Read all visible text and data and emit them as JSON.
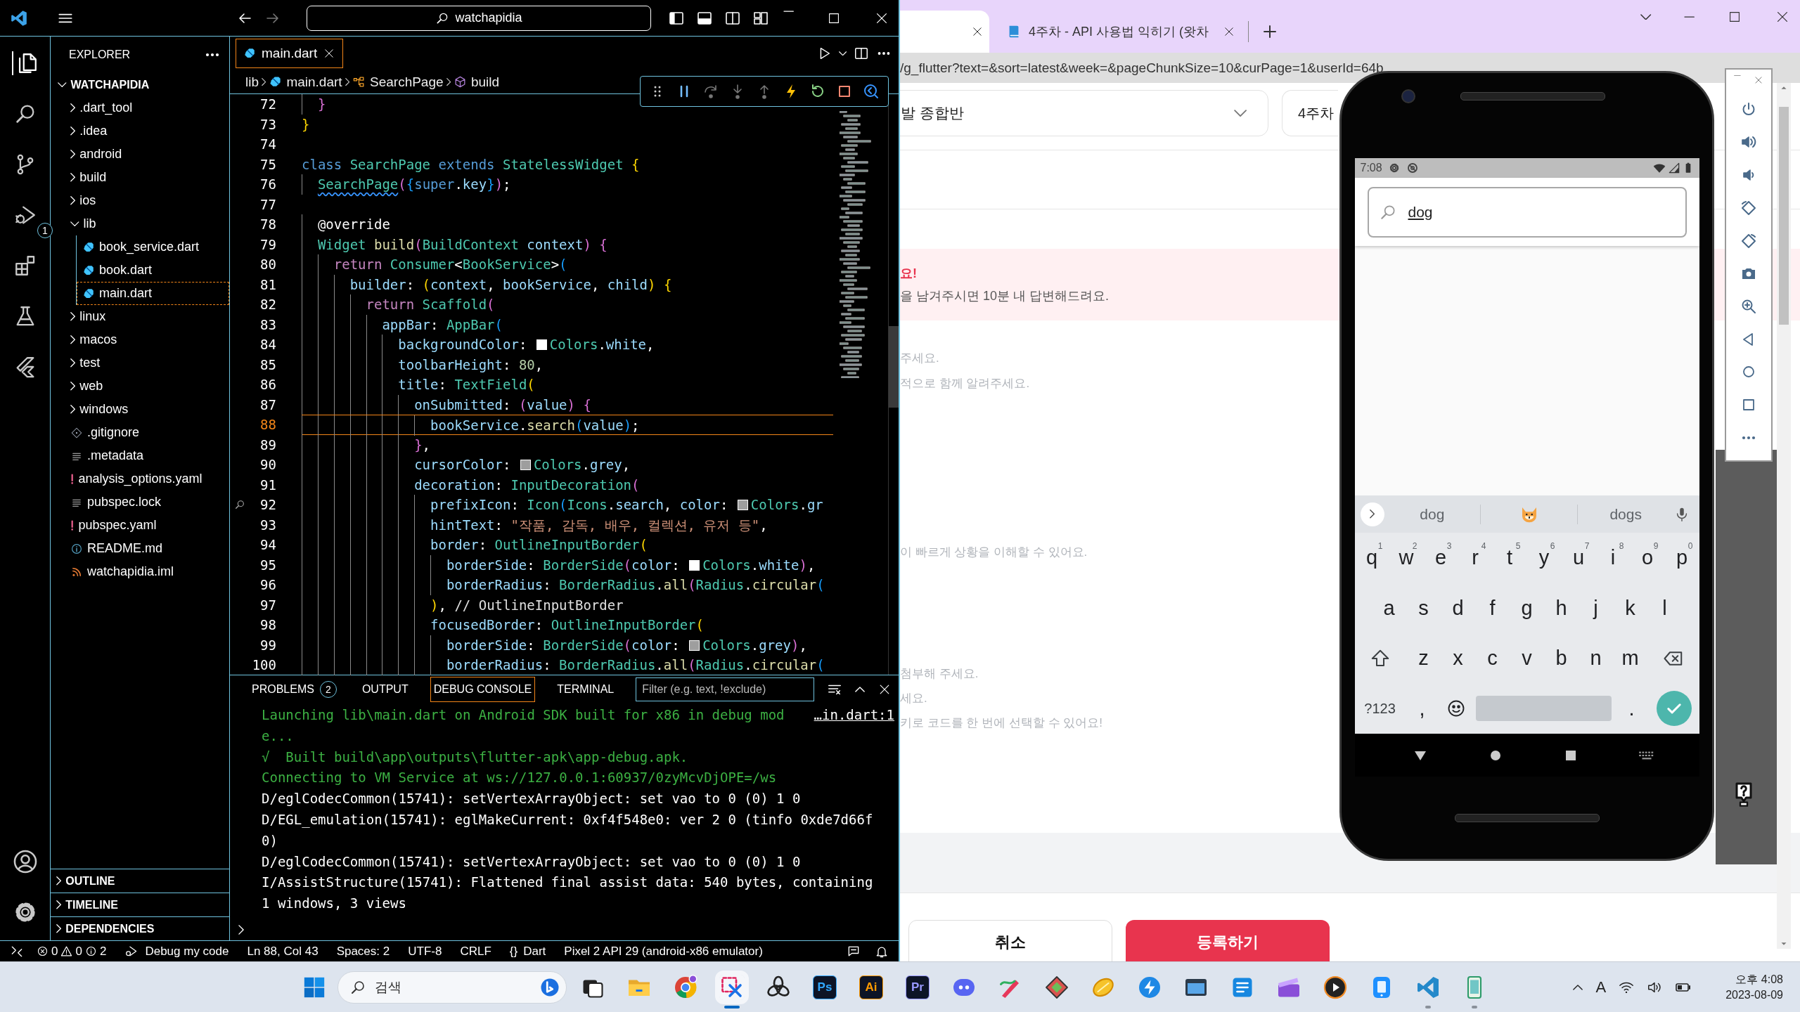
{
  "vscode": {
    "title_bar": {
      "search": "watchapidia"
    },
    "activity_bar": {
      "items": [
        {
          "kind": "explorer",
          "selected": true
        },
        {
          "kind": "search",
          "selected": false
        },
        {
          "kind": "source-control",
          "selected": false
        },
        {
          "kind": "run-debug",
          "selected": false,
          "badge": "1"
        },
        {
          "kind": "extensions",
          "selected": false
        },
        {
          "kind": "testing",
          "selected": false
        },
        {
          "kind": "flutter",
          "selected": false
        }
      ],
      "bottom": [
        {
          "kind": "account"
        },
        {
          "kind": "settings"
        }
      ]
    },
    "sidebar": {
      "title": "EXPLORER",
      "root": "WATCHAPIDIA",
      "root_expanded": true,
      "tree": [
        {
          "label": ".dart_tool",
          "kind": "folder",
          "expanded": false,
          "selected": false
        },
        {
          "label": ".idea",
          "kind": "folder",
          "expanded": false,
          "selected": false
        },
        {
          "label": "android",
          "kind": "folder",
          "expanded": false,
          "selected": false
        },
        {
          "label": "build",
          "kind": "folder",
          "expanded": false,
          "selected": false
        },
        {
          "label": "ios",
          "kind": "folder",
          "expanded": false,
          "selected": false
        },
        {
          "label": "lib",
          "kind": "folder",
          "expanded": true,
          "selected": false,
          "children": [
            {
              "label": "book_service.dart",
              "kind": "dart",
              "selected": false
            },
            {
              "label": "book.dart",
              "kind": "dart",
              "selected": false
            },
            {
              "label": "main.dart",
              "kind": "dart",
              "selected": true
            }
          ]
        },
        {
          "label": "linux",
          "kind": "folder",
          "expanded": false,
          "selected": false
        },
        {
          "label": "macos",
          "kind": "folder",
          "expanded": false,
          "selected": false
        },
        {
          "label": "test",
          "kind": "folder",
          "expanded": false,
          "selected": false
        },
        {
          "label": "web",
          "kind": "folder",
          "expanded": false,
          "selected": false
        },
        {
          "label": "windows",
          "kind": "folder",
          "expanded": false,
          "selected": false
        },
        {
          "label": ".gitignore",
          "kind": "git",
          "selected": false
        },
        {
          "label": ".metadata",
          "kind": "text",
          "selected": false
        },
        {
          "label": "analysis_options.yaml",
          "kind": "yaml",
          "selected": false
        },
        {
          "label": "pubspec.lock",
          "kind": "text",
          "selected": false
        },
        {
          "label": "pubspec.yaml",
          "kind": "yaml",
          "selected": false
        },
        {
          "label": "README.md",
          "kind": "info",
          "selected": false
        },
        {
          "label": "watchapidia.iml",
          "kind": "feed",
          "selected": false
        }
      ],
      "sections": [
        {
          "label": "OUTLINE",
          "expanded": false
        },
        {
          "label": "TIMELINE",
          "expanded": false
        },
        {
          "label": "DEPENDENCIES",
          "expanded": false
        }
      ]
    },
    "editor": {
      "tabs": [
        {
          "label": "main.dart",
          "selected": true
        }
      ],
      "breadcrumbs": [
        {
          "label": "lib",
          "kind": "folder"
        },
        {
          "label": "main.dart",
          "kind": "dart"
        },
        {
          "label": "SearchPage",
          "kind": "class"
        },
        {
          "label": "build",
          "kind": "method"
        }
      ],
      "lines": [
        {
          "number": "72",
          "current": false,
          "marker": false,
          "tokens": [
            {
              "text": "  }",
              "kind": "b2"
            }
          ]
        },
        {
          "number": "73",
          "current": false,
          "marker": false,
          "tokens": [
            {
              "text": "}",
              "kind": "b1"
            }
          ]
        },
        {
          "number": "74",
          "current": false,
          "marker": false
        },
        {
          "number": "75",
          "current": false,
          "marker": false,
          "tokens": [
            {
              "text": "class ",
              "kind": "kw"
            },
            {
              "text": "SearchPage ",
              "kind": "ty"
            },
            {
              "text": "extends ",
              "kind": "kw"
            },
            {
              "text": "StatelessWidget ",
              "kind": "ty"
            },
            {
              "text": "{",
              "kind": "b1"
            }
          ]
        },
        {
          "number": "76",
          "current": false,
          "marker": false,
          "tokens": [
            {
              "text": "  SearchPage",
              "kind": "warn"
            },
            {
              "text": "(",
              "kind": "b2"
            },
            {
              "text": "{",
              "kind": "b3"
            },
            {
              "text": "super",
              "kind": "kw"
            },
            {
              "text": ".",
              "kind": "p"
            },
            {
              "text": "key",
              "kind": "prop"
            },
            {
              "text": "}",
              "kind": "b3"
            },
            {
              "text": ")",
              "kind": "b2"
            },
            {
              "text": ";",
              "kind": "p"
            }
          ]
        },
        {
          "number": "77",
          "current": false,
          "marker": false
        },
        {
          "number": "78",
          "current": false,
          "marker": false,
          "tokens": [
            {
              "text": "  @override",
              "kind": "p"
            }
          ]
        },
        {
          "number": "79",
          "current": false,
          "marker": false,
          "tokens": [
            {
              "text": "  Widget ",
              "kind": "ty"
            },
            {
              "text": "build",
              "kind": "fn"
            },
            {
              "text": "(",
              "kind": "b2"
            },
            {
              "text": "BuildContext ",
              "kind": "ty"
            },
            {
              "text": "context",
              "kind": "prop"
            },
            {
              "text": ")",
              "kind": "b2"
            },
            {
              "text": " {",
              "kind": "b2"
            }
          ]
        },
        {
          "number": "80",
          "current": false,
          "marker": false,
          "tokens": [
            {
              "text": "    return ",
              "kind": "ctl"
            },
            {
              "text": "Consumer",
              "kind": "ty"
            },
            {
              "text": "<",
              "kind": "p"
            },
            {
              "text": "BookService",
              "kind": "ty"
            },
            {
              "text": ">",
              "kind": "p"
            },
            {
              "text": "(",
              "kind": "b3"
            }
          ]
        },
        {
          "number": "81",
          "current": false,
          "marker": false,
          "tokens": [
            {
              "text": "      builder",
              "kind": "prop"
            },
            {
              "text": ": ",
              "kind": "p"
            },
            {
              "text": "(",
              "kind": "b1"
            },
            {
              "text": "context",
              "kind": "prop"
            },
            {
              "text": ", ",
              "kind": "p"
            },
            {
              "text": "bookService",
              "kind": "prop"
            },
            {
              "text": ", ",
              "kind": "p"
            },
            {
              "text": "child",
              "kind": "prop"
            },
            {
              "text": ")",
              "kind": "b1"
            },
            {
              "text": " {",
              "kind": "b1"
            }
          ]
        },
        {
          "number": "82",
          "current": false,
          "marker": false,
          "tokens": [
            {
              "text": "        return ",
              "kind": "ctl"
            },
            {
              "text": "Scaffold",
              "kind": "ty"
            },
            {
              "text": "(",
              "kind": "b2"
            }
          ]
        },
        {
          "number": "83",
          "current": false,
          "marker": false,
          "tokens": [
            {
              "text": "          appBar",
              "kind": "prop"
            },
            {
              "text": ": ",
              "kind": "p"
            },
            {
              "text": "AppBar",
              "kind": "ty"
            },
            {
              "text": "(",
              "kind": "b3"
            }
          ]
        },
        {
          "number": "84",
          "current": false,
          "marker": false,
          "tokens": [
            {
              "text": "            backgroundColor",
              "kind": "prop"
            },
            {
              "text": ": ",
              "kind": "p"
            },
            {
              "kind": "swatch",
              "color": "#ffffff"
            },
            {
              "text": "Colors",
              "kind": "ty"
            },
            {
              "text": ".",
              "kind": "p"
            },
            {
              "text": "white",
              "kind": "prop"
            },
            {
              "text": ",",
              "kind": "p"
            }
          ]
        },
        {
          "number": "85",
          "current": false,
          "marker": false,
          "tokens": [
            {
              "text": "            toolbarHeight",
              "kind": "prop"
            },
            {
              "text": ": ",
              "kind": "p"
            },
            {
              "text": "80",
              "kind": "num"
            },
            {
              "text": ",",
              "kind": "p"
            }
          ]
        },
        {
          "number": "86",
          "current": false,
          "marker": false,
          "tokens": [
            {
              "text": "            title",
              "kind": "prop"
            },
            {
              "text": ": ",
              "kind": "p"
            },
            {
              "text": "TextField",
              "kind": "ty"
            },
            {
              "text": "(",
              "kind": "b1"
            }
          ]
        },
        {
          "number": "87",
          "current": false,
          "marker": false,
          "tokens": [
            {
              "text": "              onSubmitted",
              "kind": "prop"
            },
            {
              "text": ": ",
              "kind": "p"
            },
            {
              "text": "(",
              "kind": "b2"
            },
            {
              "text": "value",
              "kind": "prop"
            },
            {
              "text": ")",
              "kind": "b2"
            },
            {
              "text": " {",
              "kind": "b2"
            }
          ]
        },
        {
          "number": "88",
          "current": true,
          "marker": false,
          "tokens": [
            {
              "text": "                bookService",
              "kind": "prop"
            },
            {
              "text": ".",
              "kind": "p"
            },
            {
              "text": "search",
              "kind": "fn"
            },
            {
              "text": "(",
              "kind": "b3"
            },
            {
              "text": "value",
              "kind": "prop"
            },
            {
              "text": ")",
              "kind": "b3"
            },
            {
              "text": ";",
              "kind": "p"
            }
          ]
        },
        {
          "number": "89",
          "current": false,
          "marker": false,
          "tokens": [
            {
              "text": "              }",
              "kind": "b2"
            },
            {
              "text": ",",
              "kind": "p"
            }
          ]
        },
        {
          "number": "90",
          "current": false,
          "marker": false,
          "tokens": [
            {
              "text": "              cursorColor",
              "kind": "prop"
            },
            {
              "text": ": ",
              "kind": "p"
            },
            {
              "kind": "swatch",
              "color": "#9e9e9e"
            },
            {
              "text": "Colors",
              "kind": "ty"
            },
            {
              "text": ".",
              "kind": "p"
            },
            {
              "text": "grey",
              "kind": "prop"
            },
            {
              "text": ",",
              "kind": "p"
            }
          ]
        },
        {
          "number": "91",
          "current": false,
          "marker": false,
          "tokens": [
            {
              "text": "              decoration",
              "kind": "prop"
            },
            {
              "text": ": ",
              "kind": "p"
            },
            {
              "text": "InputDecoration",
              "kind": "ty"
            },
            {
              "text": "(",
              "kind": "b2"
            }
          ]
        },
        {
          "number": "92",
          "current": false,
          "marker": true,
          "tokens": [
            {
              "text": "                prefixIcon",
              "kind": "prop"
            },
            {
              "text": ": ",
              "kind": "p"
            },
            {
              "text": "Icon",
              "kind": "ty"
            },
            {
              "text": "(",
              "kind": "b3"
            },
            {
              "text": "Icons",
              "kind": "ty"
            },
            {
              "text": ".",
              "kind": "p"
            },
            {
              "text": "search",
              "kind": "prop"
            },
            {
              "text": ", ",
              "kind": "p"
            },
            {
              "text": "color",
              "kind": "prop"
            },
            {
              "text": ": ",
              "kind": "p"
            },
            {
              "kind": "swatch",
              "color": "#9e9e9e"
            },
            {
              "text": "Colors",
              "kind": "ty"
            },
            {
              "text": ".",
              "kind": "p"
            },
            {
              "text": "gr",
              "kind": "prop"
            }
          ]
        },
        {
          "number": "93",
          "current": false,
          "marker": false,
          "tokens": [
            {
              "text": "                hintText",
              "kind": "prop"
            },
            {
              "text": ": ",
              "kind": "p"
            },
            {
              "text": "\"작품, 감독, 배우, 컬렉션, 유저 등\"",
              "kind": "str"
            },
            {
              "text": ",",
              "kind": "p"
            }
          ]
        },
        {
          "number": "94",
          "current": false,
          "marker": false,
          "tokens": [
            {
              "text": "                border",
              "kind": "prop"
            },
            {
              "text": ": ",
              "kind": "p"
            },
            {
              "text": "OutlineInputBorder",
              "kind": "ty"
            },
            {
              "text": "(",
              "kind": "b1"
            }
          ]
        },
        {
          "number": "95",
          "current": false,
          "marker": false,
          "tokens": [
            {
              "text": "                  borderSide",
              "kind": "prop"
            },
            {
              "text": ": ",
              "kind": "p"
            },
            {
              "text": "BorderSide",
              "kind": "ty"
            },
            {
              "text": "(",
              "kind": "b2"
            },
            {
              "text": "color",
              "kind": "prop"
            },
            {
              "text": ": ",
              "kind": "p"
            },
            {
              "kind": "swatch",
              "color": "#ffffff"
            },
            {
              "text": "Colors",
              "kind": "ty"
            },
            {
              "text": ".",
              "kind": "p"
            },
            {
              "text": "white",
              "kind": "prop"
            },
            {
              "text": ")",
              "kind": "b2"
            },
            {
              "text": ",",
              "kind": "p"
            }
          ]
        },
        {
          "number": "96",
          "current": false,
          "marker": false,
          "tokens": [
            {
              "text": "                  borderRadius",
              "kind": "prop"
            },
            {
              "text": ": ",
              "kind": "p"
            },
            {
              "text": "BorderRadius",
              "kind": "ty"
            },
            {
              "text": ".",
              "kind": "p"
            },
            {
              "text": "all",
              "kind": "fn"
            },
            {
              "text": "(",
              "kind": "b2"
            },
            {
              "text": "Radius",
              "kind": "ty"
            },
            {
              "text": ".",
              "kind": "p"
            },
            {
              "text": "circular",
              "kind": "fn"
            },
            {
              "text": "(",
              "kind": "b3"
            }
          ]
        },
        {
          "number": "97",
          "current": false,
          "marker": false,
          "tokens": [
            {
              "text": "                )",
              "kind": "b1"
            },
            {
              "text": ", ",
              "kind": "p"
            },
            {
              "text": "// OutlineInputBorder",
              "kind": "cmt"
            }
          ]
        },
        {
          "number": "98",
          "current": false,
          "marker": false,
          "tokens": [
            {
              "text": "                focusedBorder",
              "kind": "prop"
            },
            {
              "text": ": ",
              "kind": "p"
            },
            {
              "text": "OutlineInputBorder",
              "kind": "ty"
            },
            {
              "text": "(",
              "kind": "b1"
            }
          ]
        },
        {
          "number": "99",
          "current": false,
          "marker": false,
          "tokens": [
            {
              "text": "                  borderSide",
              "kind": "prop"
            },
            {
              "text": ": ",
              "kind": "p"
            },
            {
              "text": "BorderSide",
              "kind": "ty"
            },
            {
              "text": "(",
              "kind": "b2"
            },
            {
              "text": "color",
              "kind": "prop"
            },
            {
              "text": ": ",
              "kind": "p"
            },
            {
              "kind": "swatch",
              "color": "#9e9e9e"
            },
            {
              "text": "Colors",
              "kind": "ty"
            },
            {
              "text": ".",
              "kind": "p"
            },
            {
              "text": "grey",
              "kind": "prop"
            },
            {
              "text": ")",
              "kind": "b2"
            },
            {
              "text": ",",
              "kind": "p"
            }
          ]
        },
        {
          "number": "100",
          "current": false,
          "marker": false,
          "tokens": [
            {
              "text": "                  borderRadius",
              "kind": "prop"
            },
            {
              "text": ": ",
              "kind": "p"
            },
            {
              "text": "BorderRadius",
              "kind": "ty"
            },
            {
              "text": ".",
              "kind": "p"
            },
            {
              "text": "all",
              "kind": "fn"
            },
            {
              "text": "(",
              "kind": "b2"
            },
            {
              "text": "Radius",
              "kind": "ty"
            },
            {
              "text": ".",
              "kind": "p"
            },
            {
              "text": "circular",
              "kind": "fn"
            },
            {
              "text": "(",
              "kind": "b3"
            }
          ]
        }
      ]
    },
    "panel": {
      "tabs": [
        {
          "label": "PROBLEMS",
          "selected": false,
          "badge": "2"
        },
        {
          "label": "OUTPUT",
          "selected": false
        },
        {
          "label": "DEBUG CONSOLE",
          "selected": true
        },
        {
          "label": "TERMINAL",
          "selected": false
        }
      ],
      "filter": {
        "placeholder": "Filter (e.g. text, !exclude)"
      },
      "console": [
        {
          "kind": "info",
          "text": "Launching lib\\main.dart on Android SDK built for x86 in debug mode...",
          "source": "…in.dart:1"
        },
        {
          "kind": "info",
          "text": "√  Built build\\app\\outputs\\flutter-apk\\app-debug.apk."
        },
        {
          "kind": "info",
          "text": "Connecting to VM Service at ws://127.0.0.1:60937/0zyMcvDjOPE=/ws"
        },
        {
          "kind": "log",
          "text": "D/eglCodecCommon(15741): setVertexArrayObject: set vao to 0 (0) 1 0"
        },
        {
          "kind": "log",
          "text": "D/EGL_emulation(15741): eglMakeCurrent: 0xf4f548e0: ver 2 0 (tinfo 0xde7d66f0)"
        },
        {
          "kind": "log",
          "text": "D/eglCodecCommon(15741): setVertexArrayObject: set vao to 0 (0) 1 0"
        },
        {
          "kind": "log",
          "text": "I/AssistStructure(15741): Flattened final assist data: 540 bytes, containing 1 windows, 3 views"
        }
      ]
    },
    "status_bar": {
      "errors": "0",
      "warnings": "0",
      "infos": "2",
      "launch": "Debug my code",
      "position": "Ln 88, Col 43",
      "indent": "Spaces: 2",
      "encoding": "UTF-8",
      "eol": "CRLF",
      "language": {
        "icon": "{}",
        "label": "Dart"
      },
      "device": "Pixel 2 API 29 (android-x86 emulator)"
    }
  },
  "browser": {
    "tabs": [
      {
        "selected": true
      },
      {
        "label": "4주차 - API 사용법 익히기 (왓차",
        "selected": false
      }
    ],
    "address": "/g_flutter?text=&sort=latest&week=&pageChunkSize=10&curPage=1&userId=64b",
    "page": {
      "course_select": "발 종합반",
      "week_select": "4주차",
      "notice": {
        "title": "요!",
        "text": "을 남겨주시면 10분 내 답변해드려요."
      },
      "hint_groups": [
        [
          "주세요.",
          "적으로 함께 알려주세요."
        ],
        [
          "이 빠르게 상황을 이해할 수 있어요."
        ],
        [
          "첨부해 주세요.",
          "세요.",
          "키로 코드를 한 번에 선택할 수 있어요!"
        ]
      ],
      "buttons": [
        {
          "label": "취소",
          "kind": "secondary"
        },
        {
          "label": "등록하기",
          "kind": "primary"
        }
      ]
    }
  },
  "emulator": {
    "status": {
      "time": "7:08"
    },
    "search": {
      "value": "dog",
      "composing": true
    },
    "suggestions": [
      {
        "kind": "word",
        "label": "dog"
      },
      {
        "kind": "emoji"
      },
      {
        "kind": "word",
        "label": "dogs"
      }
    ],
    "keyboard": [
      [
        {
          "kind": "char",
          "label": "q",
          "hint": "1"
        },
        {
          "kind": "char",
          "label": "w",
          "hint": "2"
        },
        {
          "kind": "char",
          "label": "e",
          "hint": "3"
        },
        {
          "kind": "char",
          "label": "r",
          "hint": "4"
        },
        {
          "kind": "char",
          "label": "t",
          "hint": "5"
        },
        {
          "kind": "char",
          "label": "y",
          "hint": "6"
        },
        {
          "kind": "char",
          "label": "u",
          "hint": "7"
        },
        {
          "kind": "char",
          "label": "i",
          "hint": "8"
        },
        {
          "kind": "char",
          "label": "o",
          "hint": "9"
        },
        {
          "kind": "char",
          "label": "p",
          "hint": "0"
        }
      ],
      [
        {
          "kind": "char",
          "label": "a"
        },
        {
          "kind": "char",
          "label": "s"
        },
        {
          "kind": "char",
          "label": "d"
        },
        {
          "kind": "char",
          "label": "f"
        },
        {
          "kind": "char",
          "label": "g"
        },
        {
          "kind": "char",
          "label": "h"
        },
        {
          "kind": "char",
          "label": "j"
        },
        {
          "kind": "char",
          "label": "k"
        },
        {
          "kind": "char",
          "label": "l"
        }
      ],
      [
        {
          "kind": "shift"
        },
        {
          "kind": "char",
          "label": "z"
        },
        {
          "kind": "char",
          "label": "x"
        },
        {
          "kind": "char",
          "label": "c"
        },
        {
          "kind": "char",
          "label": "v"
        },
        {
          "kind": "char",
          "label": "b"
        },
        {
          "kind": "char",
          "label": "n"
        },
        {
          "kind": "char",
          "label": "m"
        },
        {
          "kind": "backspace"
        }
      ],
      [
        {
          "kind": "symbols",
          "label": "?123"
        },
        {
          "kind": "char",
          "label": ","
        },
        {
          "kind": "emoji"
        },
        {
          "kind": "space"
        },
        {
          "kind": "char",
          "label": "."
        },
        {
          "kind": "enter"
        }
      ]
    ]
  },
  "taskbar": {
    "search": "검색",
    "apps": [
      {
        "kind": "task-view",
        "selected": false
      },
      {
        "kind": "folder",
        "selected": false
      },
      {
        "kind": "browser",
        "selected": false
      },
      {
        "kind": "snip",
        "open": true,
        "selected": true
      },
      {
        "kind": "knot",
        "selected": false
      },
      {
        "kind": "tile",
        "label": "Ps",
        "color": "#31a8ff",
        "selected": false
      },
      {
        "kind": "tile",
        "label": "Ai",
        "color": "#ff9a00",
        "selected": false
      },
      {
        "kind": "tile",
        "label": "Pr",
        "color": "#9999ff",
        "selected": false
      },
      {
        "kind": "chat",
        "selected": false
      },
      {
        "kind": "pen",
        "selected": false
      },
      {
        "kind": "gem",
        "selected": false
      },
      {
        "kind": "fruit",
        "selected": false
      },
      {
        "kind": "bolt",
        "selected": false
      },
      {
        "kind": "monitor",
        "selected": false
      },
      {
        "kind": "store",
        "selected": false
      },
      {
        "kind": "clapper",
        "selected": false
      },
      {
        "kind": "play",
        "selected": false
      },
      {
        "kind": "tablet",
        "selected": false
      },
      {
        "kind": "code",
        "open": true,
        "selected": false
      },
      {
        "kind": "device",
        "open": true,
        "selected": false
      }
    ],
    "ime": "A",
    "clock": {
      "time": "오후 4:08",
      "date": "2023-08-09"
    }
  }
}
